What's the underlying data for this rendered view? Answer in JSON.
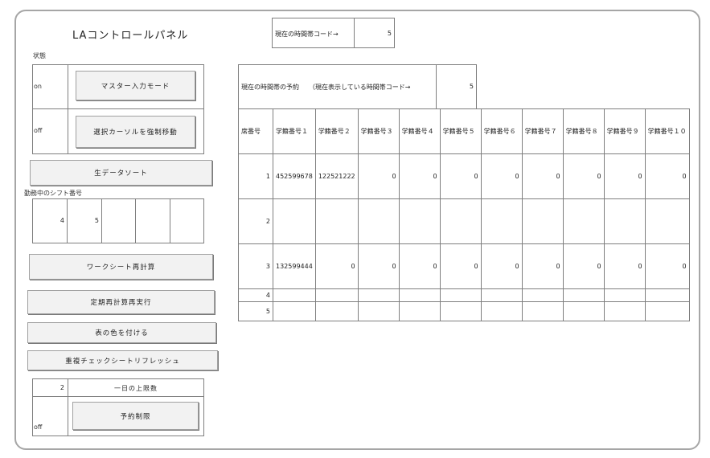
{
  "panel": {
    "title": "LAコントロールパネル",
    "status_label": "状態",
    "status_rows": [
      {
        "state": "on",
        "button": "マスター入力モード"
      },
      {
        "state": "off",
        "button": "選択カーソルを強制移動"
      }
    ],
    "sort_button": "生データソート",
    "shift_label": "勤務中のシフト番号",
    "shift_numbers": [
      "4",
      "5",
      "",
      "",
      ""
    ],
    "recalc_button": "ワークシート再計算",
    "periodic_button": "定期再計算再実行",
    "color_button": "表の色を付ける",
    "refresh_button": "重複チェックシートリフレッシュ",
    "limit_value": "2",
    "limit_label": "一日の上限数",
    "restrict_state": "off",
    "restrict_button": "予約制限"
  },
  "current_timecode": {
    "label": "現在の時間帯コード→",
    "value": "5"
  },
  "reservation": {
    "caption": "現在の時間帯の予約　　（現在表示している時間帯コード→",
    "code": "5",
    "headers": [
      "席番号",
      "学籍番号１",
      "学籍番号２",
      "学籍番号３",
      "学籍番号４",
      "学籍番号５",
      "学籍番号６",
      "学籍番号７",
      "学籍番号８",
      "学籍番号９",
      "学籍番号１０"
    ],
    "rows": [
      [
        "1",
        "452599678",
        "122521222",
        "0",
        "0",
        "0",
        "0",
        "0",
        "0",
        "0",
        "0"
      ],
      [
        "2",
        "",
        "",
        "",
        "",
        "",
        "",
        "",
        "",
        "",
        ""
      ],
      [
        "3",
        "132599444",
        "0",
        "0",
        "0",
        "0",
        "0",
        "0",
        "0",
        "0",
        "0"
      ],
      [
        "4",
        "",
        "",
        "",
        "",
        "",
        "",
        "",
        "",
        "",
        ""
      ],
      [
        "5",
        "",
        "",
        "",
        "",
        "",
        "",
        "",
        "",
        "",
        ""
      ]
    ]
  }
}
